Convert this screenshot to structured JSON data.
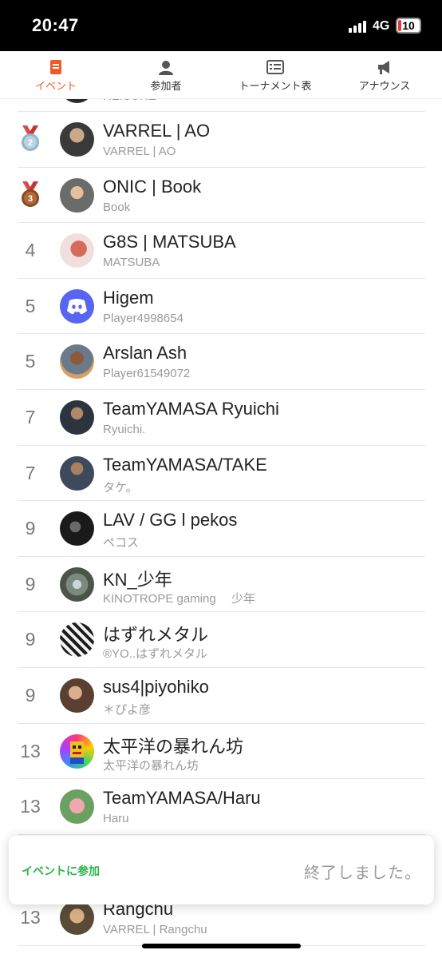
{
  "status_bar": {
    "time": "20:47",
    "network": "4G",
    "battery": "10"
  },
  "tabs": [
    {
      "label": "イベント",
      "icon": "event-doc-icon",
      "active": true
    },
    {
      "label": "参加者",
      "icon": "person-icon",
      "active": false
    },
    {
      "label": "トーナメント表",
      "icon": "bracket-list-icon",
      "active": false
    },
    {
      "label": "アナウンス",
      "icon": "megaphone-icon",
      "active": false
    }
  ],
  "accent_color": "#f05a28",
  "rankings": [
    {
      "rank": "",
      "name": "",
      "sub": "REISURE",
      "medal": "",
      "avatar": "photo-avatar"
    },
    {
      "rank": "2",
      "name": "VARREL | AO",
      "sub": "VARREL | AO",
      "medal": "silver-medal-icon",
      "avatar": "photo-avatar"
    },
    {
      "rank": "3",
      "name": "ONIC | Book",
      "sub": "Book",
      "medal": "bronze-medal-icon",
      "avatar": "photo-avatar"
    },
    {
      "rank": "4",
      "name": "G8S | MATSUBA",
      "sub": "MATSUBA",
      "medal": "",
      "avatar": "photo-avatar"
    },
    {
      "rank": "5",
      "name": "Higem",
      "sub": "Player4998654",
      "medal": "",
      "avatar": "discord-avatar"
    },
    {
      "rank": "5",
      "name": "Arslan Ash",
      "sub": "Player61549072",
      "medal": "",
      "avatar": "photo-avatar"
    },
    {
      "rank": "7",
      "name": "TeamYAMASA Ryuichi",
      "sub": "Ryuichi.",
      "medal": "",
      "avatar": "photo-avatar"
    },
    {
      "rank": "7",
      "name": "TeamYAMASA/TAKE",
      "sub": "タケ。",
      "medal": "",
      "avatar": "photo-avatar"
    },
    {
      "rank": "9",
      "name": "LAV / GG l pekos",
      "sub": "ペコス",
      "medal": "",
      "avatar": "photo-avatar"
    },
    {
      "rank": "9",
      "name": "KN_少年",
      "sub": "KINOTROPE gaming　 少年",
      "medal": "",
      "avatar": "photo-avatar"
    },
    {
      "rank": "9",
      "name": "はずれメタル",
      "sub": "®YO..はずれメタル",
      "medal": "",
      "avatar": "photo-avatar"
    },
    {
      "rank": "9",
      "name": "sus4|piyohiko",
      "sub": "＊ぴよ彦",
      "medal": "",
      "avatar": "photo-avatar"
    },
    {
      "rank": "13",
      "name": "太平洋の暴れん坊",
      "sub": "太平洋の暴れん坊",
      "medal": "",
      "avatar": "pixel-avatar"
    },
    {
      "rank": "13",
      "name": "TeamYAMASA/Haru",
      "sub": "Haru",
      "medal": "",
      "avatar": "photo-avatar"
    },
    {
      "rank": "13",
      "name": "",
      "sub": "",
      "medal": "",
      "avatar": "photo-avatar"
    },
    {
      "rank": "13",
      "name": "Rangchu",
      "sub": "VARREL | Rangchu",
      "medal": "",
      "avatar": "photo-avatar"
    }
  ],
  "join_card": {
    "join_label": "イベントに参加",
    "status_text": "終了しました。",
    "join_color": "#2bb34a"
  }
}
